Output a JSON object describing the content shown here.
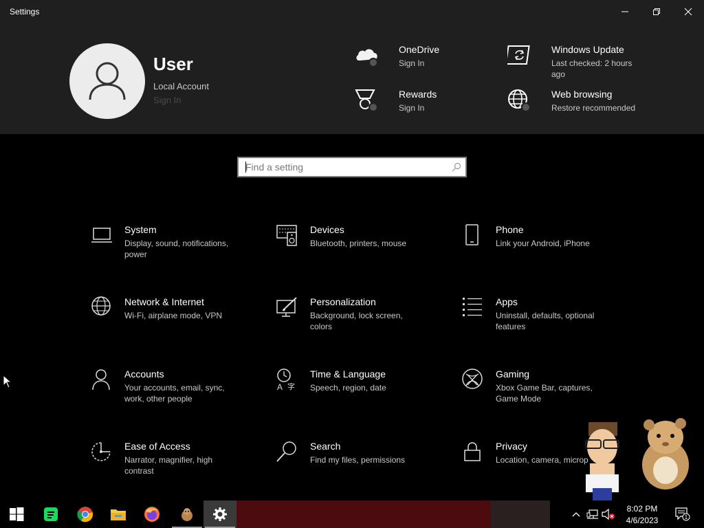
{
  "window": {
    "title": "Settings"
  },
  "user": {
    "name": "User",
    "account_type": "Local Account",
    "sign_in": "Sign In"
  },
  "header_items": [
    {
      "title": "OneDrive",
      "subtitle": "Sign In",
      "icon": "cloud-icon"
    },
    {
      "title": "Windows Update",
      "subtitle": "Last checked: 2 hours ago",
      "icon": "update-icon"
    },
    {
      "title": "Rewards",
      "subtitle": "Sign In",
      "icon": "medal-icon"
    },
    {
      "title": "Web browsing",
      "subtitle": "Restore recommended",
      "icon": "globe-icon"
    }
  ],
  "search": {
    "placeholder": "Find a setting"
  },
  "categories": [
    {
      "title": "System",
      "subtitle": "Display, sound, notifications, power",
      "icon": "laptop-icon"
    },
    {
      "title": "Devices",
      "subtitle": "Bluetooth, printers, mouse",
      "icon": "keyboard-speaker-icon"
    },
    {
      "title": "Phone",
      "subtitle": "Link your Android, iPhone",
      "icon": "phone-icon"
    },
    {
      "title": "Network & Internet",
      "subtitle": "Wi-Fi, airplane mode, VPN",
      "icon": "globe-icon"
    },
    {
      "title": "Personalization",
      "subtitle": "Background, lock screen, colors",
      "icon": "paint-brush-icon"
    },
    {
      "title": "Apps",
      "subtitle": "Uninstall, defaults, optional features",
      "icon": "apps-list-icon"
    },
    {
      "title": "Accounts",
      "subtitle": "Your accounts, email, sync, work, other people",
      "icon": "person-icon"
    },
    {
      "title": "Time & Language",
      "subtitle": "Speech, region, date",
      "icon": "time-language-icon"
    },
    {
      "title": "Gaming",
      "subtitle": "Xbox Game Bar, captures, Game Mode",
      "icon": "xbox-icon"
    },
    {
      "title": "Ease of Access",
      "subtitle": "Narrator, magnifier, high contrast",
      "icon": "ease-of-access-icon"
    },
    {
      "title": "Search",
      "subtitle": "Find my files, permissions",
      "icon": "magnifier-icon"
    },
    {
      "title": "Privacy",
      "subtitle": "Location, camera, microp",
      "icon": "lock-icon"
    }
  ],
  "taskbar": {
    "apps": [
      "start-icon",
      "spotify-icon",
      "chrome-icon",
      "file-explorer-icon",
      "firefox-icon",
      "hamster-app-icon",
      "settings-gear-icon"
    ],
    "time": "8:02 PM",
    "date": "4/6/2023",
    "notification_count": "1"
  }
}
